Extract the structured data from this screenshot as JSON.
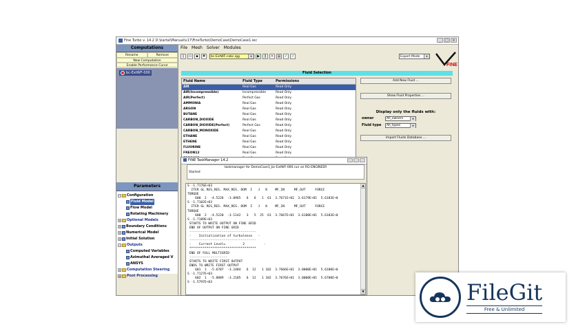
{
  "window": {
    "title": "Fine Turbo v. 14.2    D:\\kartal\\Manual\\v17\\FineTurbo\\DemoCase\\DemoCase1.iec"
  },
  "left": {
    "computations_header": "Computations",
    "rename_label": "Rename",
    "remove_label": "Remove",
    "new_computation_label": "New Computation",
    "enable_performance_curve_label": "Enable Performance Curve",
    "project_item": "bc-ExtWF-000",
    "parameters_header": "Parameters",
    "tree": [
      "Configuration",
      "Fluid Model",
      "Flow Model",
      "Rotating Machinery",
      "Optional Models",
      "Boundary Conditions",
      "Numerical Model",
      "Initial Solution",
      "Outputs",
      "Computed Variables",
      "Azimuthal Averaged V",
      "ANSYS",
      "Computation Steering",
      "Post Processing"
    ]
  },
  "menu": [
    "File",
    "Mesh",
    "Solver",
    "Modules"
  ],
  "toolbar": {
    "project_combo": "bc-ExtWF-cabc.igg",
    "mode_combo": "Expert Mode",
    "logo_text": "FINE"
  },
  "fluid": {
    "band": "Fluid Selection",
    "headers": [
      "Fluid Name",
      "Fluid Type",
      "Permissions"
    ],
    "rows": [
      [
        "AIR",
        "Real Gas",
        "Read Only"
      ],
      [
        "AIR(Incompressible)",
        "Incompressible",
        "Read Only"
      ],
      [
        "AIR(Perfect)",
        "Perfect Gas",
        "Read Only"
      ],
      [
        "AMMONIA",
        "Real Gas",
        "Read Only"
      ],
      [
        "ARGON",
        "Real Gas",
        "Read Only"
      ],
      [
        "BUTANE",
        "Real Gas",
        "Read Only"
      ],
      [
        "CARBON_DIOXIDE",
        "Real Gas",
        "Read Only"
      ],
      [
        "CARBON_DIOXIDE(Perfect)",
        "Perfect Gas",
        "Read Only"
      ],
      [
        "CARBON_MONOXIDE",
        "Real Gas",
        "Read Only"
      ],
      [
        "ETHANE",
        "Real Gas",
        "Read Only"
      ],
      [
        "ETHENE",
        "Real Gas",
        "Read Only"
      ],
      [
        "FLUORINE",
        "Real Gas",
        "Read Only"
      ],
      [
        "FREON12",
        "Real Gas",
        "Read Only"
      ],
      [
        "FREON22",
        "Real Gas",
        "Read Only"
      ]
    ],
    "add_button": "Add New Fluid ...",
    "props_button": "Show Fluid Properties ...",
    "filter_title": "Display only the fluids with:",
    "owner_label": "owner",
    "owner_value": "All_owners",
    "type_label": "Fluid type",
    "type_value": "All_types",
    "import_button": "Import Fluids Database ..."
  },
  "taskmanager": {
    "title": "FINE TaskManager 14.2",
    "project_line": "taskmanager for DemoCase1_bc-ExtWF-000.run on RG-ENGINEER",
    "status": "Started",
    "log": [
      "S -1.7176E+03",
      "  ITER GL RES_RES. MAX_RES. DOM  I   J   K    MF_IN     MF_OUT     FORCE",
      "TORQUE",
      "    600  2  -4.5226  -3.0965   6   6   1  61  3.7671E+01  3.6179E+01  5.6183E+0",
      "S -1.7102E+03",
      "  ITER GL RES_RES. MAX_RES. DOM  I   J   K    MF_IN     MF_OUT     FORCE",
      "TORQUE",
      "    600  2  -4.5220  -3.1142   3   5  25  61  3.7667E+01  3.6180E+01  5.6183E+0",
      "S -1.7189E+03",
      " STARTS TO WRITE OUTPUT ON FINE GRID",
      " END OF OUTPUT ON FINE GRID",
      " -----------------------------------",
      " -    Initialization of turbulence   -",
      " -----------------------------------",
      " -    Current Level=         2          -",
      " ***********************************",
      " END OF FULL MULTIGRID",
      " --------------------",
      " STARTS TO WRITE FIRST OUTPUT",
      " ENDS TO WRITE FIRST OUTPUT",
      "    601  1  -5.6707  -3.2484   6  12   1 102  3.7666E+01  3.0000E+01  5.6180E+0",
      "S -1.7127E+03",
      "    602  1  -5.8889  -3.2185   6  12   1 102  3.7676E+01  3.0000E+01  5.6708E+0",
      "S -1.5797E+03"
    ]
  },
  "watermark": {
    "name": "FileGit",
    "tagline": "Free & Unlimited"
  }
}
